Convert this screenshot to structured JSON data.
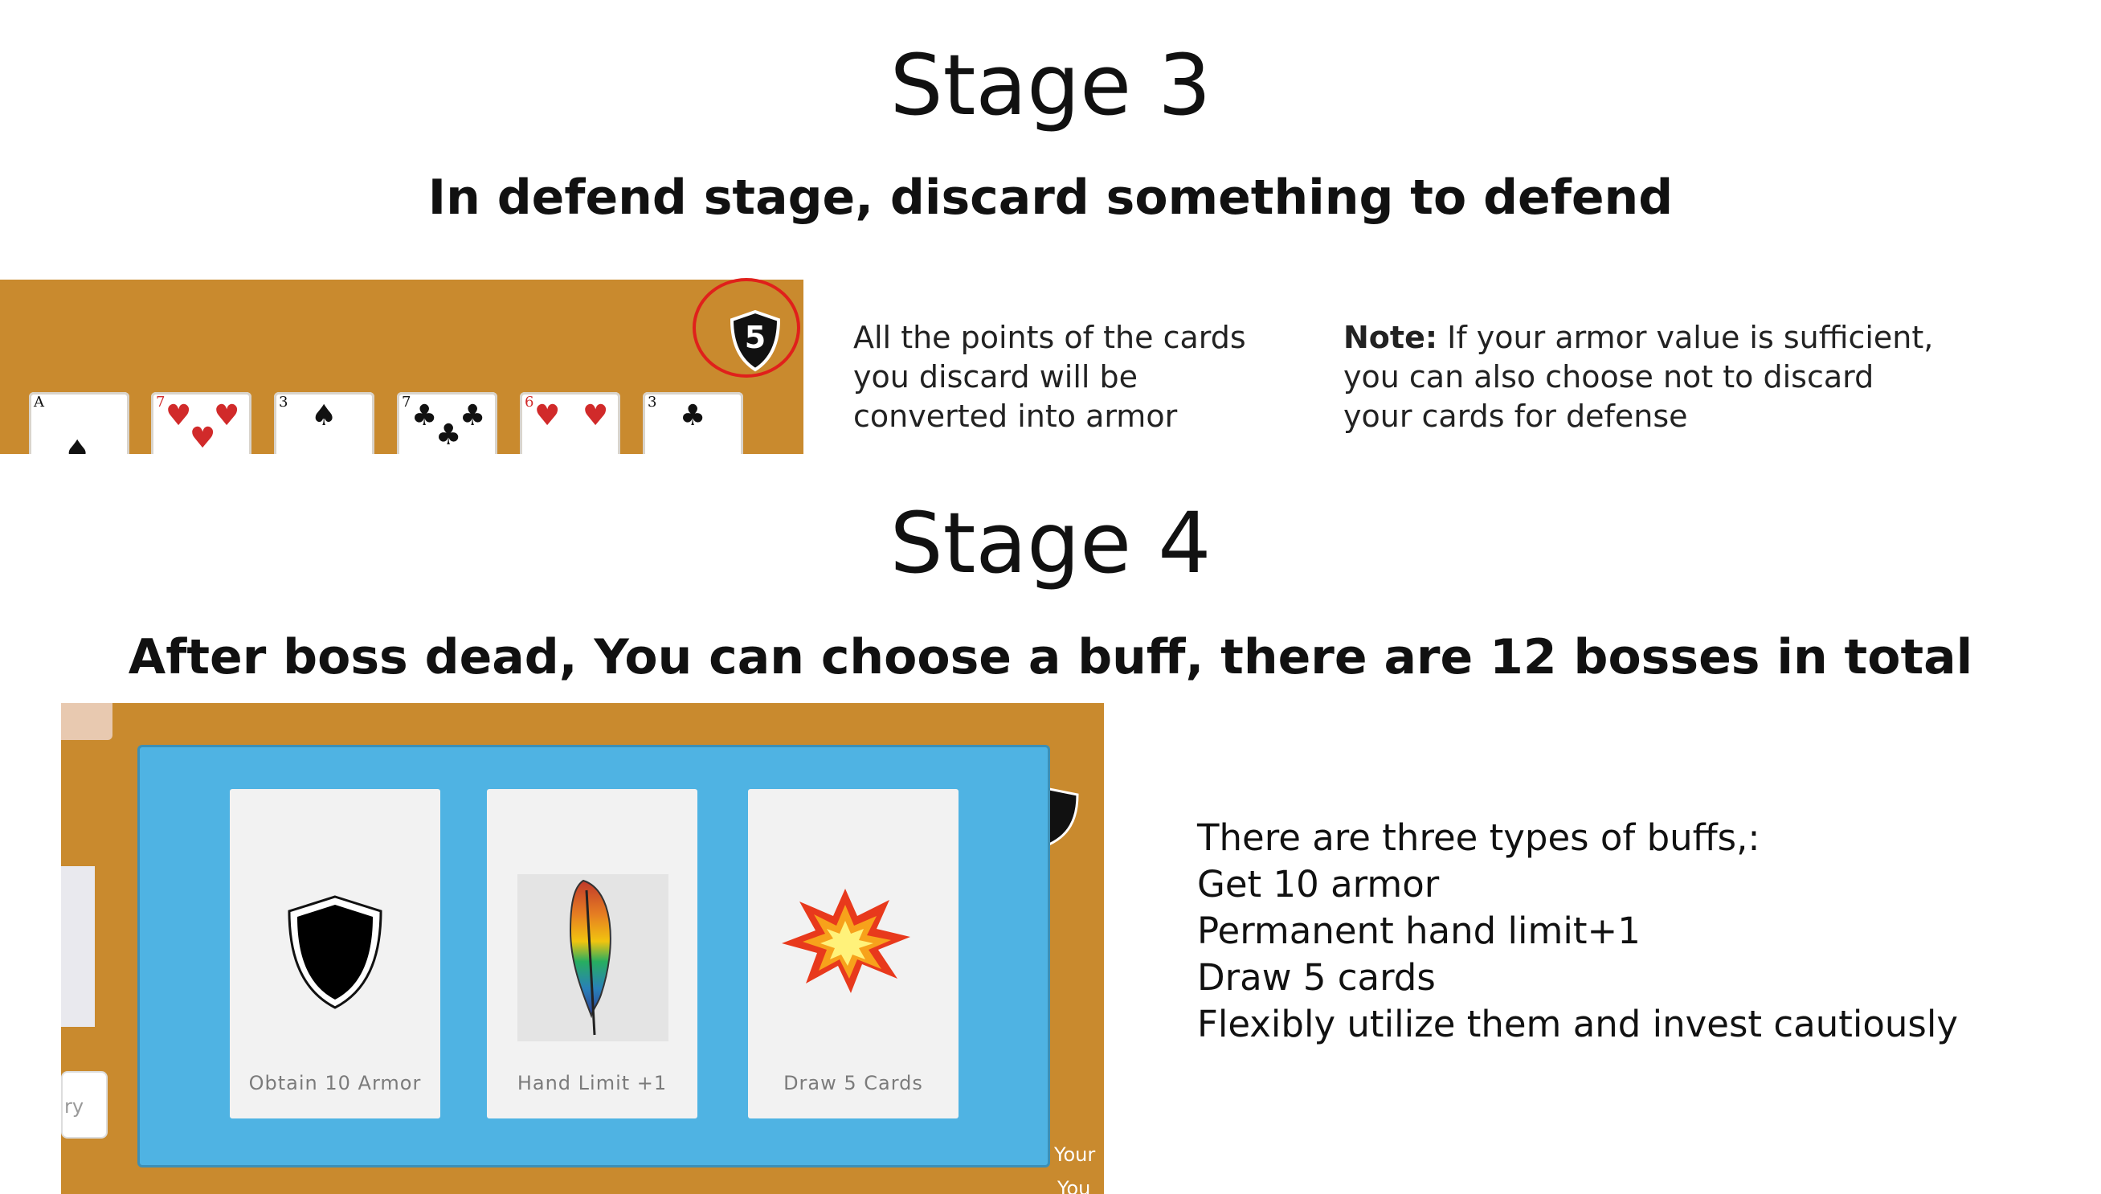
{
  "stage3": {
    "title": "Stage 3",
    "subtitle": "In defend stage, discard something to defend",
    "armor_badge": "5",
    "cards": [
      {
        "rank": "A",
        "suit": "♠",
        "color": "#111111"
      },
      {
        "rank": "7",
        "suit": "♥",
        "color": "#d12a2a"
      },
      {
        "rank": "3",
        "suit": "♠",
        "color": "#111111"
      },
      {
        "rank": "7",
        "suit": "♣",
        "color": "#111111"
      },
      {
        "rank": "6",
        "suit": "♥",
        "color": "#d12a2a"
      },
      {
        "rank": "3",
        "suit": "♣",
        "color": "#111111"
      }
    ],
    "description_lines": [
      "All the points of the cards",
      "you discard will be",
      "converted into armor"
    ],
    "note_label": "Note:",
    "note_line1_rest": " If your armor value is sufficient,",
    "note_lines": [
      "you can also choose not to discard",
      "your cards for defense"
    ]
  },
  "stage4": {
    "title": "Stage 4",
    "subtitle": "After boss dead, You can choose a buff, there are 12 bosses in total",
    "buffs": [
      {
        "label": "Obtain 10 Armor",
        "icon": "shield-icon"
      },
      {
        "label": "Hand Limit +1",
        "icon": "feather-icon"
      },
      {
        "label": "Draw 5 Cards",
        "icon": "explosion-icon"
      }
    ],
    "side_text_fragments": [
      "Your",
      "You"
    ],
    "input_fragment": "ry",
    "description_lines": [
      "There are three types of buffs,:",
      "Get 10 armor",
      "Permanent hand limit+1",
      "Draw 5 cards",
      "Flexibly utilize them and invest cautiously"
    ]
  },
  "colors": {
    "board": "#c98a2e",
    "modal": "#4fb3e3",
    "card": "#f2f2f2",
    "highlight_ring": "#e0201b"
  }
}
